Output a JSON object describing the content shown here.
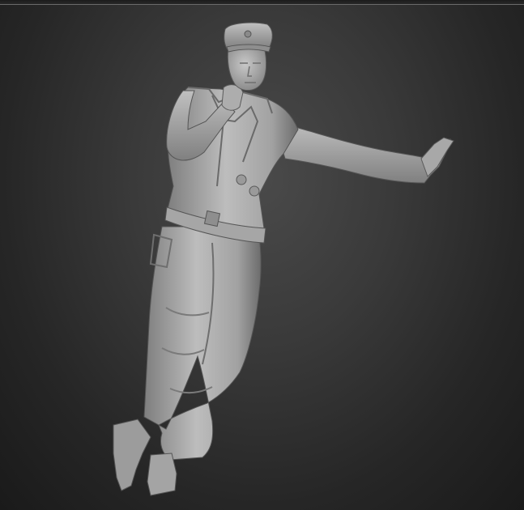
{
  "viewport": {
    "background_top": "#4a4a4a",
    "background_bottom": "#1a1a1a"
  },
  "model": {
    "material_light": "#b9b9b9",
    "material_mid": "#8e8e8e",
    "material_dark": "#565656"
  }
}
